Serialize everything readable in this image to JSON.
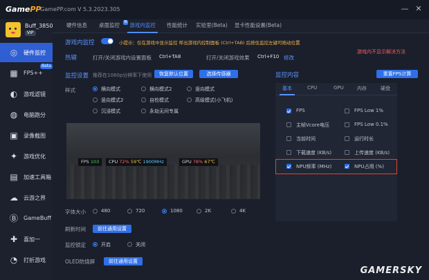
{
  "titlebar": {
    "logo_a": "Game",
    "logo_b": "PP",
    "site": "GamePP.com",
    "version": "V 5.3.2023.305",
    "minimize": "—",
    "close": "✕"
  },
  "profile": {
    "name": "Buff_3850...",
    "badge": "VIP"
  },
  "sidebar": {
    "items": [
      {
        "label": "硬件监控",
        "icon": "◎"
      },
      {
        "label": "FPS++",
        "icon": "▦",
        "badge": "Beta"
      },
      {
        "label": "游戏滤镜",
        "icon": "◐"
      },
      {
        "label": "电脑跑分",
        "icon": "◍"
      },
      {
        "label": "录像截图",
        "icon": "▣"
      },
      {
        "label": "游戏优化",
        "icon": "✦"
      },
      {
        "label": "加速工具箱",
        "icon": "▤"
      },
      {
        "label": "云游之界",
        "icon": "☁"
      },
      {
        "label": "GameBuff",
        "icon": "Ⓑ"
      },
      {
        "label": "喜加一",
        "icon": "✚"
      },
      {
        "label": "打折游戏",
        "icon": "◔"
      }
    ]
  },
  "tabs": [
    {
      "label": "硬件信息"
    },
    {
      "label": "桌面监控"
    },
    {
      "label": "游戏内监控"
    },
    {
      "label": "性能统计"
    },
    {
      "label": "实验室(Beta)"
    },
    {
      "label": "显卡性能设置(Beta)"
    }
  ],
  "main": {
    "section_title": "游戏内监控",
    "hint": "小提示：仅在游戏中显示监控 呼出游戏内控制面板 (Ctrl+TAB) 后按住监控左键可拖动位置",
    "hotkey_label": "热键",
    "hotkey_panel_label": "打开/关闭游戏内设置面板",
    "hotkey_panel_value": "Ctrl+TA8",
    "hotkey_effect_label": "打开/关闭游戏效果",
    "hotkey_effect_value": "Ctrl+F10",
    "hotkey_edit": "修改",
    "red_note": "游戏内不显示解决方法",
    "monitor_settings_title": "监控设置",
    "monitor_settings_hint": "推荐在1080p分辨率下使用",
    "restore_btn": "恢复默认位置",
    "sensor_btn": "选择传感器",
    "style_label": "样式",
    "styles": [
      {
        "label": "横向模式",
        "checked": true
      },
      {
        "label": "横向模式2",
        "checked": false
      },
      {
        "label": "竖向模式",
        "checked": false
      },
      {
        "label": "竖向模式2",
        "checked": false
      },
      {
        "label": "自检模式",
        "checked": false
      },
      {
        "label": "高级模式(小飞机)",
        "checked": false
      },
      {
        "label": "沉浸模式",
        "checked": false
      },
      {
        "label": "永劫无间专属",
        "checked": false
      }
    ],
    "hud": {
      "fps_label": "FPS",
      "fps_value": "103",
      "cpu_label": "CPU",
      "cpu_usage": "72%",
      "cpu_temp": "59℃",
      "cpu_freq": "1900MHz",
      "gpu_label": "GPU",
      "gpu_usage": "78%",
      "gpu_temp": "67℃"
    },
    "font_size_label": "字体大小",
    "font_sizes": [
      {
        "label": "480",
        "checked": false
      },
      {
        "label": "720",
        "checked": false
      },
      {
        "label": "1080",
        "checked": true
      },
      {
        "label": "2K",
        "checked": false
      },
      {
        "label": "4K",
        "checked": false
      }
    ],
    "refresh_label": "刷新时间",
    "refresh_btn": "前往通用设置",
    "monitor_hotkey_label": "监控锁定",
    "monitor_on": "开启",
    "monitor_off": "关闭",
    "oled_label": "OLED防烧屏",
    "oled_btn": "前往通用设置"
  },
  "panel": {
    "title": "监控内容",
    "reset_btn": "重置FPS计算",
    "tabs": [
      "基本",
      "CPU",
      "GPU",
      "内存",
      "硬盘"
    ],
    "items": [
      {
        "label": "FPS",
        "checked": true
      },
      {
        "label": "FPS Low 1%",
        "checked": false
      },
      {
        "label": "主帧Vcore电压",
        "checked": false
      },
      {
        "label": "FPS Low 0.1%",
        "checked": false
      },
      {
        "label": "当前时间",
        "checked": false
      },
      {
        "label": "运行时长",
        "checked": false
      },
      {
        "label": "下载速度 (KB/s)",
        "checked": false
      },
      {
        "label": "上传速度 (KB/s)",
        "checked": false
      },
      {
        "label": "NPU频率 (MHz)",
        "checked": true
      },
      {
        "label": "NPU占用 (%)",
        "checked": true
      }
    ]
  },
  "watermark": "GAMERSKY",
  "colors": {
    "accent": "#2f6fe8",
    "highlight_box": "#e8452c",
    "background": "#1a1f2b"
  }
}
